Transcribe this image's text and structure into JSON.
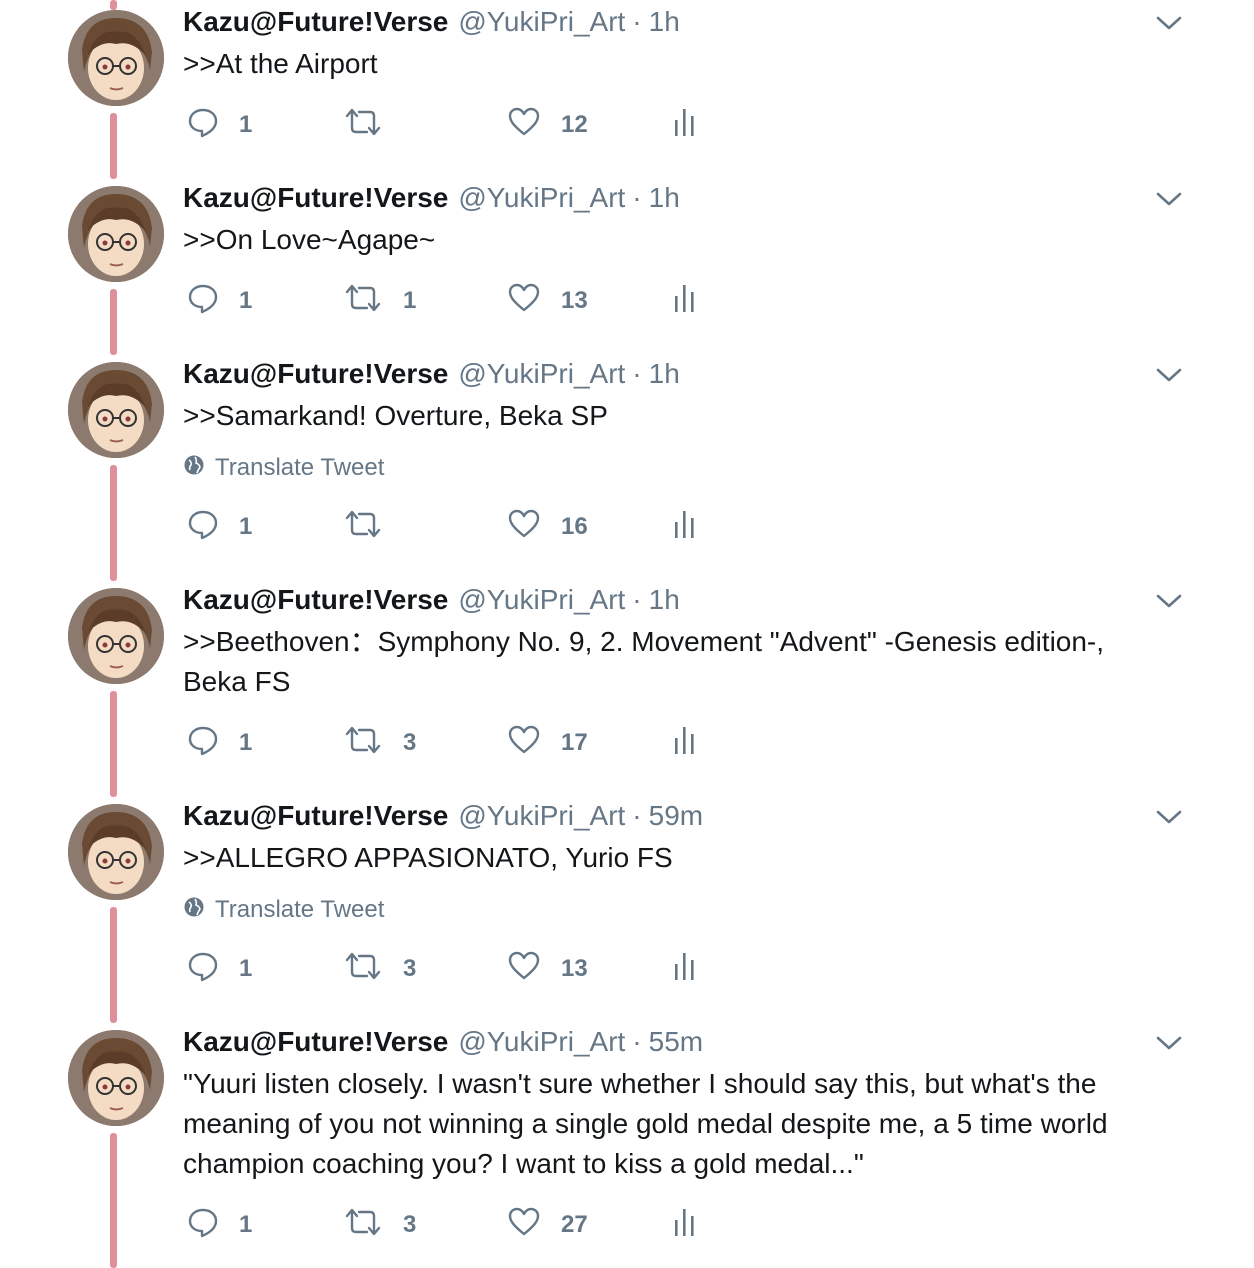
{
  "tweets": [
    {
      "name": "Kazu@Future!Verse",
      "handle": "@YukiPri_Art",
      "dot": "·",
      "time": "1h",
      "text": ">>At the Airport",
      "translate": "",
      "replies": "1",
      "retweets": "",
      "likes": "12"
    },
    {
      "name": "Kazu@Future!Verse",
      "handle": "@YukiPri_Art",
      "dot": "·",
      "time": "1h",
      "text": ">>On Love~Agape~",
      "translate": "",
      "replies": "1",
      "retweets": "1",
      "likes": "13"
    },
    {
      "name": "Kazu@Future!Verse",
      "handle": "@YukiPri_Art",
      "dot": "·",
      "time": "1h",
      "text": ">>Samarkand! Overture, Beka SP",
      "translate": "Translate Tweet",
      "replies": "1",
      "retweets": "",
      "likes": "16"
    },
    {
      "name": "Kazu@Future!Verse",
      "handle": "@YukiPri_Art",
      "dot": "·",
      "time": "1h",
      "text": ">>Beethoven：Symphony No. 9, 2. Movement \"Advent\" -Genesis edition-, Beka FS",
      "translate": "",
      "replies": "1",
      "retweets": "3",
      "likes": "17"
    },
    {
      "name": "Kazu@Future!Verse",
      "handle": "@YukiPri_Art",
      "dot": "·",
      "time": "59m",
      "text": ">>ALLEGRO APPASIONATO, Yurio FS",
      "translate": "Translate Tweet",
      "replies": "1",
      "retweets": "3",
      "likes": "13"
    },
    {
      "name": "Kazu@Future!Verse",
      "handle": "@YukiPri_Art",
      "dot": "·",
      "time": "55m",
      "text": "\"Yuuri listen closely. I wasn't sure whether I should say this, but what's the meaning of you not winning a single gold medal despite me, a 5 time world champion coaching you? I want to kiss a gold medal...\"",
      "translate": "",
      "replies": "1",
      "retweets": "3",
      "likes": "27"
    }
  ],
  "icons": {
    "avatar": "avatar-illustration",
    "reply": "reply-bubble-icon",
    "retweet": "retweet-arrows-icon",
    "like": "heart-icon",
    "analytics": "bar-chart-icon",
    "more": "chevron-down-icon",
    "translate": "globe-icon"
  },
  "colors": {
    "thread_line": "#e0909c",
    "muted": "#657786",
    "text": "#14171a"
  }
}
